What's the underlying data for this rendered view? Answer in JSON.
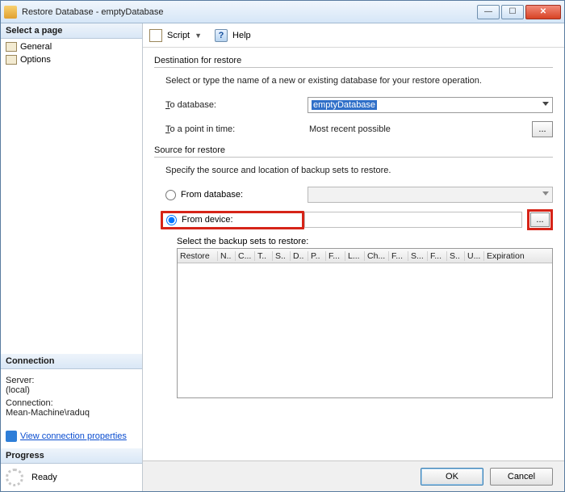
{
  "window": {
    "title": "Restore Database - emptyDatabase"
  },
  "left": {
    "select_page": "Select a page",
    "pages": [
      "General",
      "Options"
    ],
    "connection_header": "Connection",
    "server_label": "Server:",
    "server_value": "(local)",
    "connection_label": "Connection:",
    "connection_value": "Mean-Machine\\raduq",
    "view_props": "View connection properties",
    "progress_header": "Progress",
    "progress_status": "Ready"
  },
  "toolbar": {
    "script": "Script",
    "help": "Help"
  },
  "dest": {
    "title": "Destination for restore",
    "desc": "Select or type the name of a new or existing database for your restore operation.",
    "to_db_label_pre": "T",
    "to_db_label_post": "o database:",
    "to_db_value": "emptyDatabase",
    "pit_label_pre": "T",
    "pit_label_post": "o a point in time:",
    "pit_value": "Most recent possible"
  },
  "source": {
    "title": "Source for restore",
    "desc": "Specify the source and location of backup sets to restore.",
    "from_db_label": "From database:",
    "from_device_label": "From device:",
    "sets_label": "Select the backup sets to restore:",
    "device_value": ""
  },
  "grid_cols": [
    "Restore",
    "N..",
    "C...",
    "T..",
    "S..",
    "D..",
    "P..",
    "F...",
    "L...",
    "Ch...",
    "F...",
    "S...",
    "F...",
    "S..",
    "U...",
    "Expiration"
  ],
  "footer": {
    "ok": "OK",
    "cancel": "Cancel"
  },
  "dots": "..."
}
